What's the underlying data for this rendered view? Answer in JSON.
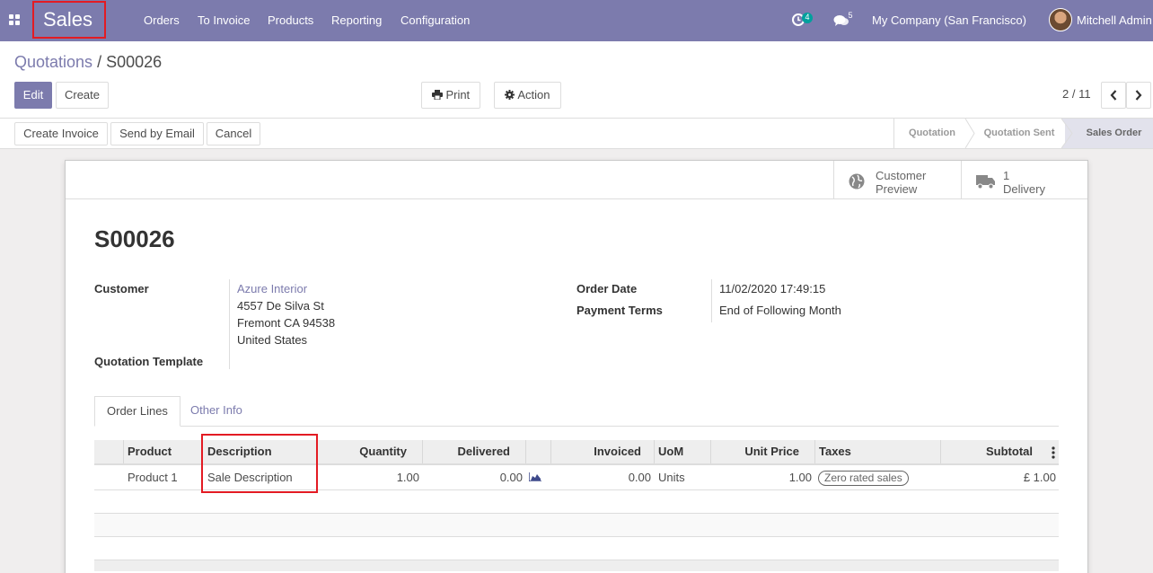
{
  "navbar": {
    "brand": "Sales",
    "menu": [
      "Orders",
      "To Invoice",
      "Products",
      "Reporting",
      "Configuration"
    ],
    "activity_count": "4",
    "message_count": "5",
    "company": "My Company (San Francisco)",
    "user": "Mitchell Admin",
    "accent_color": "#7c7bad"
  },
  "breadcrumb": {
    "parent": "Quotations",
    "separator": "/",
    "current": "S00026"
  },
  "buttons": {
    "edit": "Edit",
    "create": "Create",
    "print": "Print",
    "action": "Action",
    "create_invoice": "Create Invoice",
    "send_by_email": "Send by Email",
    "cancel": "Cancel"
  },
  "pager": {
    "value": "2 / 11"
  },
  "statusbar": [
    "Quotation",
    "Quotation Sent",
    "Sales Order"
  ],
  "smart_buttons": {
    "customer_preview": {
      "line1": "Customer",
      "line2": "Preview",
      "icon": "globe-icon"
    },
    "delivery": {
      "count": "1",
      "label": "Delivery",
      "icon": "truck-icon"
    }
  },
  "record": {
    "name": "S00026",
    "customer_label": "Customer",
    "customer_name": "Azure Interior",
    "address": [
      "4557 De Silva St",
      "Fremont CA 94538",
      "United States"
    ],
    "template_label": "Quotation Template",
    "order_date_label": "Order Date",
    "order_date": "11/02/2020 17:49:15",
    "payment_terms_label": "Payment Terms",
    "payment_terms": "End of Following Month"
  },
  "tabs": [
    "Order Lines",
    "Other Info"
  ],
  "order_lines": {
    "columns": [
      "Product",
      "Description",
      "Quantity",
      "Delivered",
      "Invoiced",
      "UoM",
      "Unit Price",
      "Taxes",
      "Subtotal"
    ],
    "rows": [
      {
        "product": "Product 1",
        "description": "Sale Description",
        "quantity": "1.00",
        "delivered": "0.00",
        "invoiced": "0.00",
        "uom": "Units",
        "unit_price": "1.00",
        "taxes": "Zero rated sales",
        "subtotal": "£ 1.00"
      }
    ]
  }
}
